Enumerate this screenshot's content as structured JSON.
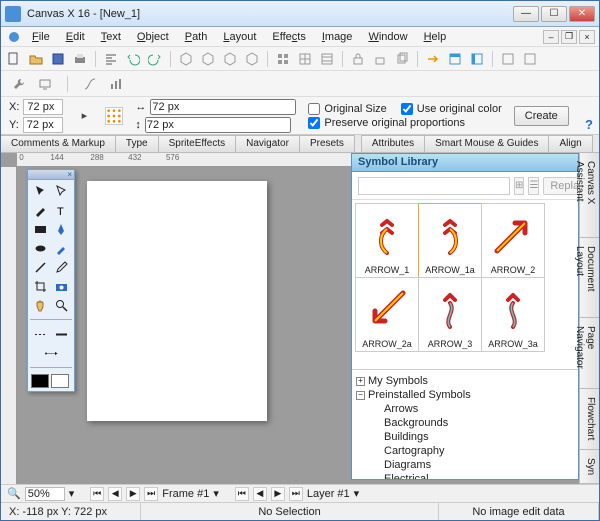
{
  "window": {
    "title": "Canvas X 16 - [New_1]"
  },
  "menu": {
    "file": "File",
    "edit": "Edit",
    "text": "Text",
    "object": "Object",
    "path": "Path",
    "layout": "Layout",
    "effects": "Effects",
    "image": "Image",
    "window": "Window",
    "help": "Help"
  },
  "options": {
    "x_label": "X:",
    "x_val": "72 px",
    "y_label": "Y:",
    "y_val": "72 px",
    "w_val": "72 px",
    "h_val": "72 px",
    "original_size": "Original Size",
    "use_orig_color": "Use original color",
    "preserve": "Preserve original proportions",
    "create": "Create"
  },
  "tabs_left": [
    "Comments & Markup",
    "Type",
    "SpriteEffects",
    "Navigator",
    "Presets"
  ],
  "tabs_right": [
    "Attributes",
    "Smart Mouse & Guides",
    "Align"
  ],
  "symbol": {
    "title": "Symbol Library",
    "replace": "Replace",
    "cells": [
      {
        "name": "ARROW_1"
      },
      {
        "name": "ARROW_1a",
        "sel": true
      },
      {
        "name": "ARROW_2"
      },
      {
        "name": "ARROW_2a"
      },
      {
        "name": "ARROW_3"
      },
      {
        "name": "ARROW_3a"
      }
    ],
    "tree": {
      "root1": "My Symbols",
      "root2": "Preinstalled Symbols",
      "children": [
        "Arrows",
        "Backgrounds",
        "Buildings",
        "Cartography",
        "Diagrams",
        "Electrical"
      ]
    }
  },
  "vtabs": [
    "Canvas X Assistant",
    "Document Layout",
    "Page Navigator",
    "Flowchart",
    "Syn"
  ],
  "frame": {
    "label": "Frame #1",
    "layer": "Layer #1"
  },
  "status": {
    "zoom": "50%",
    "coords": "X: -118 px Y: 722 px",
    "sel": "No Selection",
    "img": "No image edit data"
  }
}
